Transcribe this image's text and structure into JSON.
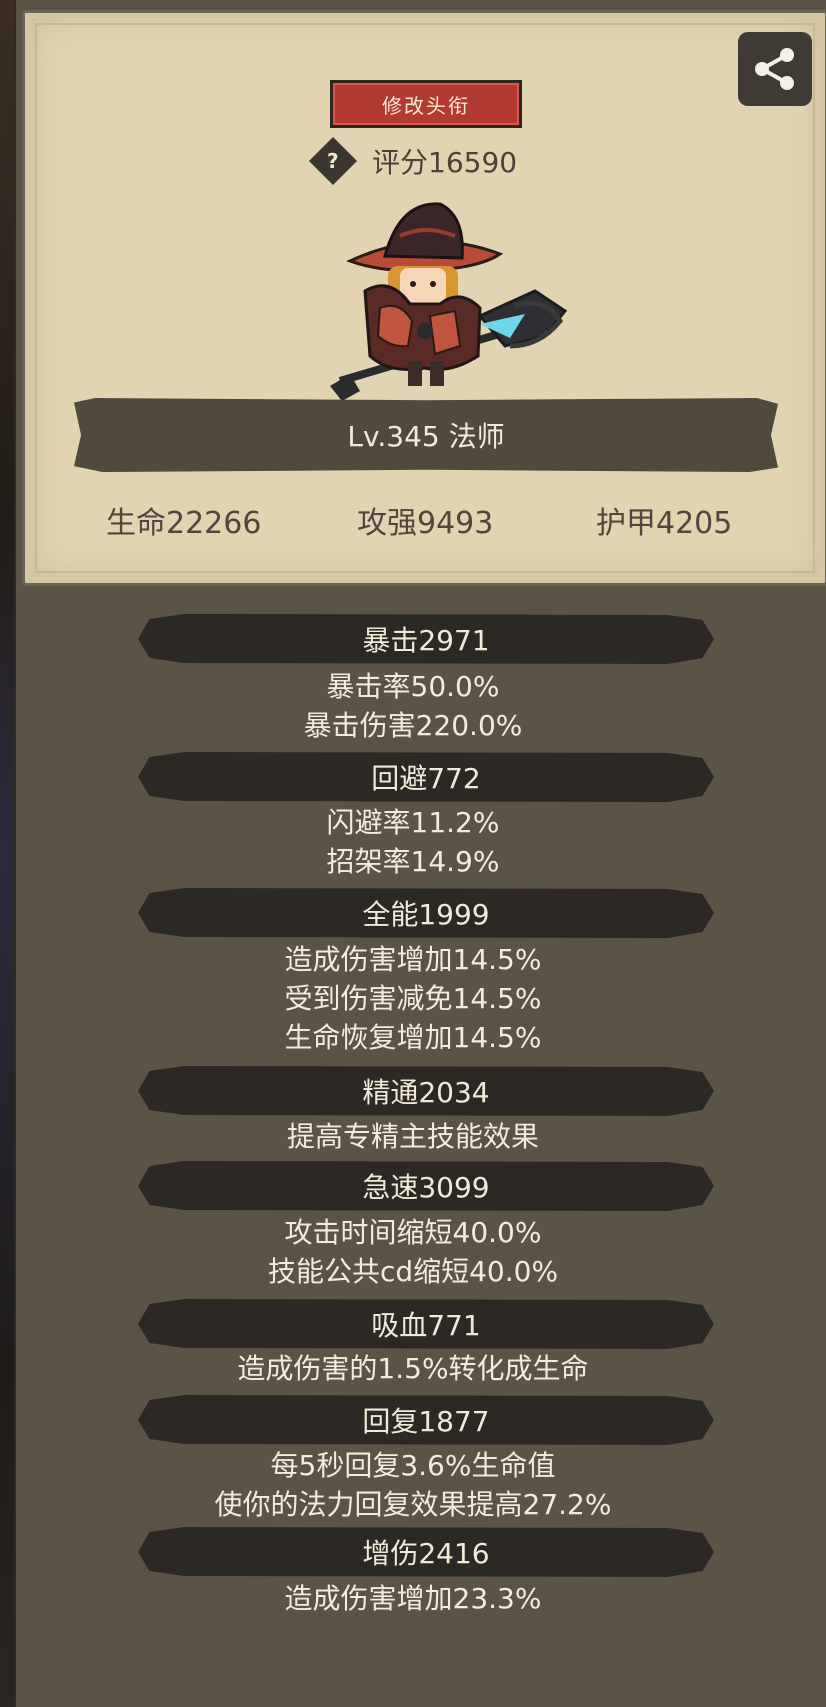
{
  "card": {
    "rename_button": "修改头衔",
    "help_symbol": "?",
    "score": "评分16590",
    "level_class": "Lv.345 法师",
    "stats": {
      "hp": "生命22266",
      "attack": "攻强9493",
      "armor": "护甲4205"
    }
  },
  "sections": [
    {
      "header": "暴击2971",
      "lines": [
        "暴击率50.0%",
        "暴击伤害220.0%"
      ]
    },
    {
      "header": "回避772",
      "lines": [
        "闪避率11.2%",
        "招架率14.9%"
      ]
    },
    {
      "header": "全能1999",
      "lines": [
        "造成伤害增加14.5%",
        "受到伤害减免14.5%",
        "生命恢复增加14.5%"
      ]
    },
    {
      "header": "精通2034",
      "lines": [
        "提高专精主技能效果"
      ]
    },
    {
      "header": "急速3099",
      "lines": [
        "攻击时间缩短40.0%",
        "技能公共cd缩短40.0%"
      ]
    },
    {
      "header": "吸血771",
      "lines": [
        "造成伤害的1.5%转化成生命"
      ]
    },
    {
      "header": "回复1877",
      "lines": [
        "每5秒回复3.6%生命值",
        "使你的法力回复效果提高27.2%"
      ]
    },
    {
      "header": "增伤2416",
      "lines": [
        "造成伤害增加23.3%"
      ]
    }
  ],
  "icons": {
    "share": "share-icon",
    "help": "question-diamond-icon",
    "character": "mage-character-icon"
  },
  "colors": {
    "parchment": "#e2d4b3",
    "panel": "#5b5446",
    "button_red": "#b23a33",
    "header_dark": "#2c2823"
  }
}
